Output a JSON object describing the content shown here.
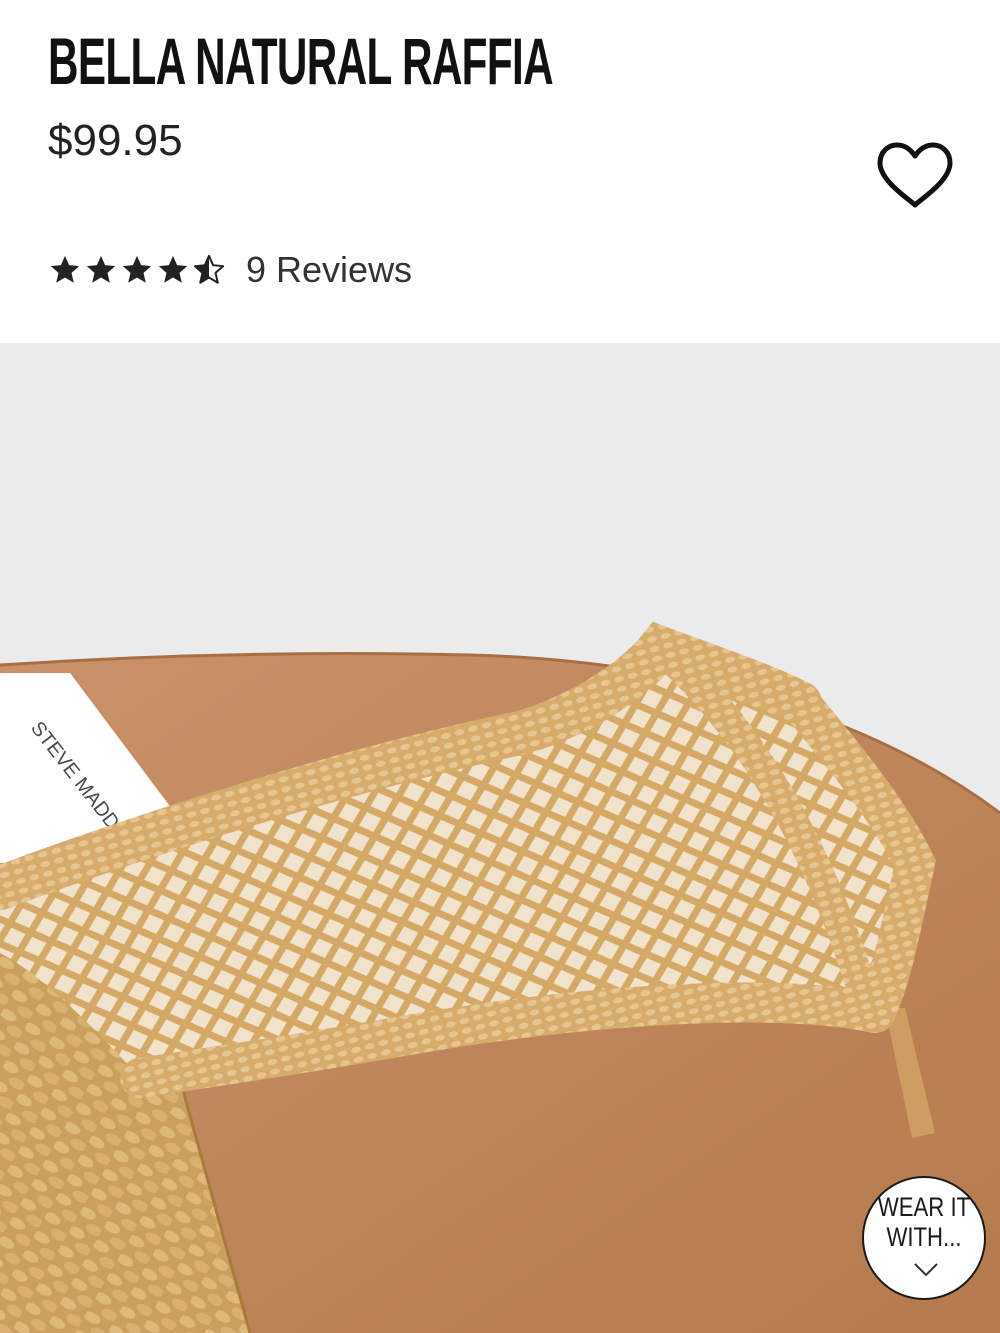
{
  "product": {
    "title": "BELLA NATURAL RAFFIA",
    "price": "$99.95"
  },
  "rating": {
    "value": 4.5,
    "max": 5,
    "reviews_label": "9 Reviews"
  },
  "image": {
    "brand_label": "STEVE MADDEN"
  },
  "wear_it_with": {
    "line1": "WEAR IT",
    "line2": "WITH..."
  },
  "icons": {
    "wishlist": "heart-outline-icon",
    "star": "star-icon",
    "chevron": "chevron-down-icon"
  },
  "colors": {
    "text": "#111111",
    "raffia": "#d8b074",
    "footbed": "#c08a5c",
    "background": "#ebebeb"
  }
}
